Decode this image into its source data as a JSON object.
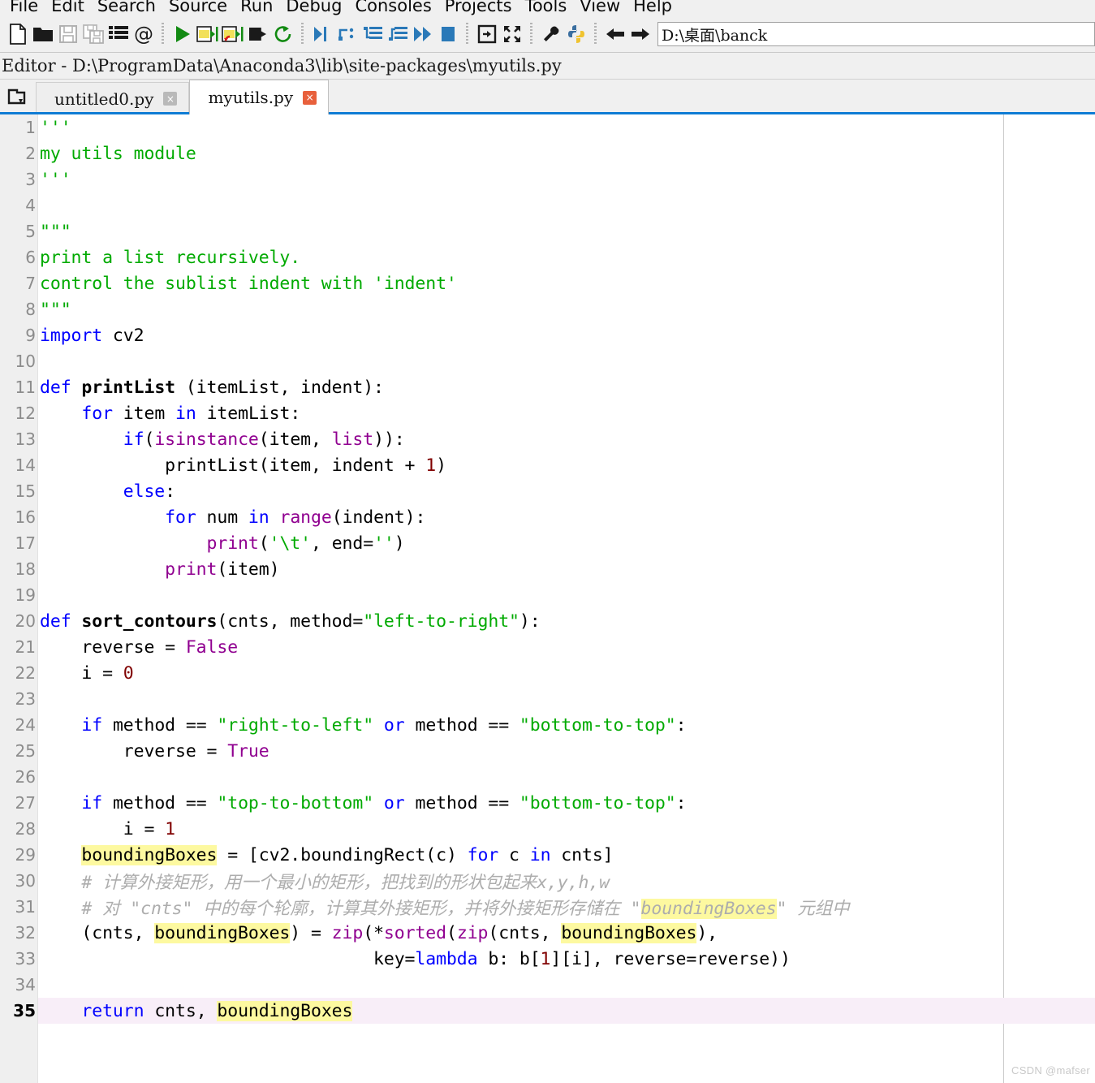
{
  "menu": {
    "items": [
      {
        "label": "File"
      },
      {
        "label": "Edit"
      },
      {
        "label": "Search"
      },
      {
        "label": "Source"
      },
      {
        "label": "Run"
      },
      {
        "label": "Debug"
      },
      {
        "label": "Consoles"
      },
      {
        "label": "Projects"
      },
      {
        "label": "Tools"
      },
      {
        "label": "View"
      },
      {
        "label": "Help"
      }
    ]
  },
  "toolbar": {
    "groups": [
      [
        "new-file-icon",
        "open-file-icon",
        "save-file-icon",
        "save-all-icon",
        "list-icon",
        "at-icon"
      ],
      [
        "run-icon",
        "run-cell-icon",
        "run-cell-advance-icon",
        "run-selection-icon",
        "rerun-icon"
      ],
      [
        "debug-icon",
        "step-over-icon",
        "step-into-icon",
        "step-return-icon",
        "continue-icon",
        "stop-icon"
      ],
      [
        "maximize-pane-icon",
        "fullscreen-icon"
      ],
      [
        "preferences-icon",
        "pythonpath-icon"
      ],
      [
        "back-icon",
        "forward-icon"
      ]
    ],
    "path_value": "D:\\桌面\\banck"
  },
  "editor_header": {
    "title": "Editor - D:\\ProgramData\\Anaconda3\\lib\\site-packages\\myutils.py"
  },
  "tabbar": {
    "browse_icon": "browse-tabs-icon",
    "tabs": [
      {
        "label": "untitled0.py",
        "active": false,
        "close": "×"
      },
      {
        "label": "myutils.py",
        "active": true,
        "close": "×"
      }
    ]
  },
  "watermark": "CSDN @mafser",
  "code": {
    "lines": [
      {
        "n": "1",
        "current": false,
        "tokens": [
          {
            "t": "'''",
            "c": "str"
          }
        ]
      },
      {
        "n": "2",
        "current": false,
        "tokens": [
          {
            "t": "my utils module",
            "c": "str"
          }
        ]
      },
      {
        "n": "3",
        "current": false,
        "tokens": [
          {
            "t": "'''",
            "c": "str"
          }
        ]
      },
      {
        "n": "4",
        "current": false,
        "tokens": []
      },
      {
        "n": "5",
        "current": false,
        "tokens": [
          {
            "t": "\"\"\"",
            "c": "str"
          }
        ]
      },
      {
        "n": "6",
        "current": false,
        "tokens": [
          {
            "t": "print a list recursively.",
            "c": "str"
          }
        ]
      },
      {
        "n": "7",
        "current": false,
        "tokens": [
          {
            "t": "control the sublist indent with 'indent'",
            "c": "str"
          }
        ]
      },
      {
        "n": "8",
        "current": false,
        "tokens": [
          {
            "t": "\"\"\"",
            "c": "str"
          }
        ]
      },
      {
        "n": "9",
        "current": false,
        "tokens": [
          {
            "t": "import",
            "c": "kw"
          },
          {
            "t": " cv2",
            "c": ""
          }
        ]
      },
      {
        "n": "10",
        "current": false,
        "tokens": []
      },
      {
        "n": "11",
        "current": false,
        "tokens": [
          {
            "t": "def",
            "c": "kw"
          },
          {
            "t": " ",
            "c": ""
          },
          {
            "t": "printList",
            "c": "fn"
          },
          {
            "t": " (itemList, indent):",
            "c": ""
          }
        ]
      },
      {
        "n": "12",
        "current": false,
        "tokens": [
          {
            "t": "    ",
            "c": ""
          },
          {
            "t": "for",
            "c": "kw"
          },
          {
            "t": " item ",
            "c": ""
          },
          {
            "t": "in",
            "c": "kw"
          },
          {
            "t": " itemList:",
            "c": ""
          }
        ]
      },
      {
        "n": "13",
        "current": false,
        "tokens": [
          {
            "t": "        ",
            "c": ""
          },
          {
            "t": "if",
            "c": "kw"
          },
          {
            "t": "(",
            "c": ""
          },
          {
            "t": "isinstance",
            "c": "bi"
          },
          {
            "t": "(item, ",
            "c": ""
          },
          {
            "t": "list",
            "c": "bi"
          },
          {
            "t": ")):",
            "c": ""
          }
        ]
      },
      {
        "n": "14",
        "current": false,
        "tokens": [
          {
            "t": "            printList(item, indent + ",
            "c": ""
          },
          {
            "t": "1",
            "c": "num"
          },
          {
            "t": ")",
            "c": ""
          }
        ]
      },
      {
        "n": "15",
        "current": false,
        "tokens": [
          {
            "t": "        ",
            "c": ""
          },
          {
            "t": "else",
            "c": "kw"
          },
          {
            "t": ":",
            "c": ""
          }
        ]
      },
      {
        "n": "16",
        "current": false,
        "tokens": [
          {
            "t": "            ",
            "c": ""
          },
          {
            "t": "for",
            "c": "kw"
          },
          {
            "t": " num ",
            "c": ""
          },
          {
            "t": "in",
            "c": "kw"
          },
          {
            "t": " ",
            "c": ""
          },
          {
            "t": "range",
            "c": "bi"
          },
          {
            "t": "(indent):",
            "c": ""
          }
        ]
      },
      {
        "n": "17",
        "current": false,
        "tokens": [
          {
            "t": "                ",
            "c": ""
          },
          {
            "t": "print",
            "c": "bi"
          },
          {
            "t": "(",
            "c": ""
          },
          {
            "t": "'\\t'",
            "c": "str"
          },
          {
            "t": ", end=",
            "c": ""
          },
          {
            "t": "''",
            "c": "str"
          },
          {
            "t": ")",
            "c": ""
          }
        ]
      },
      {
        "n": "18",
        "current": false,
        "tokens": [
          {
            "t": "            ",
            "c": ""
          },
          {
            "t": "print",
            "c": "bi"
          },
          {
            "t": "(item)",
            "c": ""
          }
        ]
      },
      {
        "n": "19",
        "current": false,
        "tokens": []
      },
      {
        "n": "20",
        "current": false,
        "tokens": [
          {
            "t": "def",
            "c": "kw"
          },
          {
            "t": " ",
            "c": ""
          },
          {
            "t": "sort_contours",
            "c": "fn"
          },
          {
            "t": "(cnts, method=",
            "c": ""
          },
          {
            "t": "\"left-to-right\"",
            "c": "str"
          },
          {
            "t": "):",
            "c": ""
          }
        ]
      },
      {
        "n": "21",
        "current": false,
        "tokens": [
          {
            "t": "    reverse = ",
            "c": ""
          },
          {
            "t": "False",
            "c": "bi"
          }
        ]
      },
      {
        "n": "22",
        "current": false,
        "tokens": [
          {
            "t": "    i = ",
            "c": ""
          },
          {
            "t": "0",
            "c": "num"
          }
        ]
      },
      {
        "n": "23",
        "current": false,
        "tokens": []
      },
      {
        "n": "24",
        "current": false,
        "tokens": [
          {
            "t": "    ",
            "c": ""
          },
          {
            "t": "if",
            "c": "kw"
          },
          {
            "t": " method == ",
            "c": ""
          },
          {
            "t": "\"right-to-left\"",
            "c": "str"
          },
          {
            "t": " ",
            "c": ""
          },
          {
            "t": "or",
            "c": "kw"
          },
          {
            "t": " method == ",
            "c": ""
          },
          {
            "t": "\"bottom-to-top\"",
            "c": "str"
          },
          {
            "t": ":",
            "c": ""
          }
        ]
      },
      {
        "n": "25",
        "current": false,
        "tokens": [
          {
            "t": "        reverse = ",
            "c": ""
          },
          {
            "t": "True",
            "c": "bi"
          }
        ]
      },
      {
        "n": "26",
        "current": false,
        "tokens": []
      },
      {
        "n": "27",
        "current": false,
        "tokens": [
          {
            "t": "    ",
            "c": ""
          },
          {
            "t": "if",
            "c": "kw"
          },
          {
            "t": " method == ",
            "c": ""
          },
          {
            "t": "\"top-to-bottom\"",
            "c": "str"
          },
          {
            "t": " ",
            "c": ""
          },
          {
            "t": "or",
            "c": "kw"
          },
          {
            "t": " method == ",
            "c": ""
          },
          {
            "t": "\"bottom-to-top\"",
            "c": "str"
          },
          {
            "t": ":",
            "c": ""
          }
        ]
      },
      {
        "n": "28",
        "current": false,
        "tokens": [
          {
            "t": "        i = ",
            "c": ""
          },
          {
            "t": "1",
            "c": "num"
          }
        ]
      },
      {
        "n": "29",
        "current": false,
        "tokens": [
          {
            "t": "    ",
            "c": ""
          },
          {
            "t": "boundingBoxes",
            "c": "hl"
          },
          {
            "t": " = [cv2.boundingRect(c) ",
            "c": ""
          },
          {
            "t": "for",
            "c": "kw"
          },
          {
            "t": " c ",
            "c": ""
          },
          {
            "t": "in",
            "c": "kw"
          },
          {
            "t": " cnts]",
            "c": ""
          }
        ]
      },
      {
        "n": "30",
        "current": false,
        "tokens": [
          {
            "t": "    # 计算外接矩形，用一个最小的矩形，把找到的形状包起来x,y,h,w",
            "c": "cmt"
          }
        ]
      },
      {
        "n": "31",
        "current": false,
        "tokens": [
          {
            "t": "    # 对 \"cnts\" 中的每个轮廓，计算其外接矩形，并将外接矩形存储在 \"",
            "c": "cmt"
          },
          {
            "t": "boundingBoxes",
            "c": "cmt hl"
          },
          {
            "t": "\" 元组中",
            "c": "cmt"
          }
        ]
      },
      {
        "n": "32",
        "current": false,
        "tokens": [
          {
            "t": "    (cnts, ",
            "c": ""
          },
          {
            "t": "boundingBoxes",
            "c": "hl"
          },
          {
            "t": ") = ",
            "c": ""
          },
          {
            "t": "zip",
            "c": "bi"
          },
          {
            "t": "(*",
            "c": ""
          },
          {
            "t": "sorted",
            "c": "bi"
          },
          {
            "t": "(",
            "c": ""
          },
          {
            "t": "zip",
            "c": "bi"
          },
          {
            "t": "(cnts, ",
            "c": ""
          },
          {
            "t": "boundingBoxes",
            "c": "hl"
          },
          {
            "t": "),",
            "c": ""
          }
        ]
      },
      {
        "n": "33",
        "current": false,
        "tokens": [
          {
            "t": "                                key=",
            "c": ""
          },
          {
            "t": "lambda",
            "c": "kw"
          },
          {
            "t": " b: b[",
            "c": ""
          },
          {
            "t": "1",
            "c": "num"
          },
          {
            "t": "][i], reverse=reverse))",
            "c": ""
          }
        ]
      },
      {
        "n": "34",
        "current": false,
        "tokens": []
      },
      {
        "n": "35",
        "current": true,
        "tokens": [
          {
            "t": "    ",
            "c": ""
          },
          {
            "t": "return",
            "c": "kw"
          },
          {
            "t": " cnts, ",
            "c": ""
          },
          {
            "t": "boundingBoxes",
            "c": "hl"
          }
        ]
      }
    ]
  },
  "colors": {
    "keyword": "#0000ff",
    "builtin": "#900090",
    "string": "#00aa00",
    "number": "#800000",
    "comment": "#adadad",
    "highlight": "#fdf9a0",
    "current_line": "#f8eef8",
    "accent": "#0f7cd4"
  }
}
